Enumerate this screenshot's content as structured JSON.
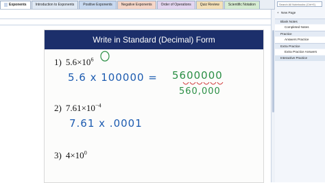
{
  "tabs": [
    {
      "label": "Exponents",
      "active": true
    },
    {
      "label": "Introduction to Exponents"
    },
    {
      "label": "Positive Exponents"
    },
    {
      "label": "Negative Exponents"
    },
    {
      "label": "Order of Operations"
    },
    {
      "label": "Quiz Review"
    },
    {
      "label": "Scientific Notation"
    }
  ],
  "search": {
    "placeholder": "Search All Notebooks (Ctrl+E)"
  },
  "sidepanel": {
    "new_page": "New Page",
    "pages": [
      {
        "label": "Blank Notes",
        "kind": "section"
      },
      {
        "label": "Completed Notes",
        "kind": "sub"
      },
      {
        "label": "Practice",
        "kind": "section"
      },
      {
        "label": "Answers Practice",
        "kind": "sub"
      },
      {
        "label": "Extra Practice",
        "kind": "section"
      },
      {
        "label": "Extra Practice Answers",
        "kind": "sub"
      },
      {
        "label": "Interactive Practice",
        "kind": "hdr"
      }
    ]
  },
  "slide": {
    "title": "Write in Standard  (Decimal) Form",
    "problems": [
      {
        "num": "1)",
        "base": "5.6×10",
        "exp": "6"
      },
      {
        "num": "2)",
        "base": "7.61×10",
        "exp": "−4"
      },
      {
        "num": "3)",
        "base": "4×10",
        "exp": "0"
      }
    ],
    "handwriting": {
      "line1": "5.6 x 100000 =",
      "line1_result": "5600000",
      "line1_answer": "560,000",
      "line2": "7.61 x .0001"
    }
  },
  "colors": {
    "banner": "#1c2f6b",
    "pen_blue": "#1c5bb0",
    "pen_green": "#2a8e44",
    "pen_red": "#cc2a2a"
  }
}
